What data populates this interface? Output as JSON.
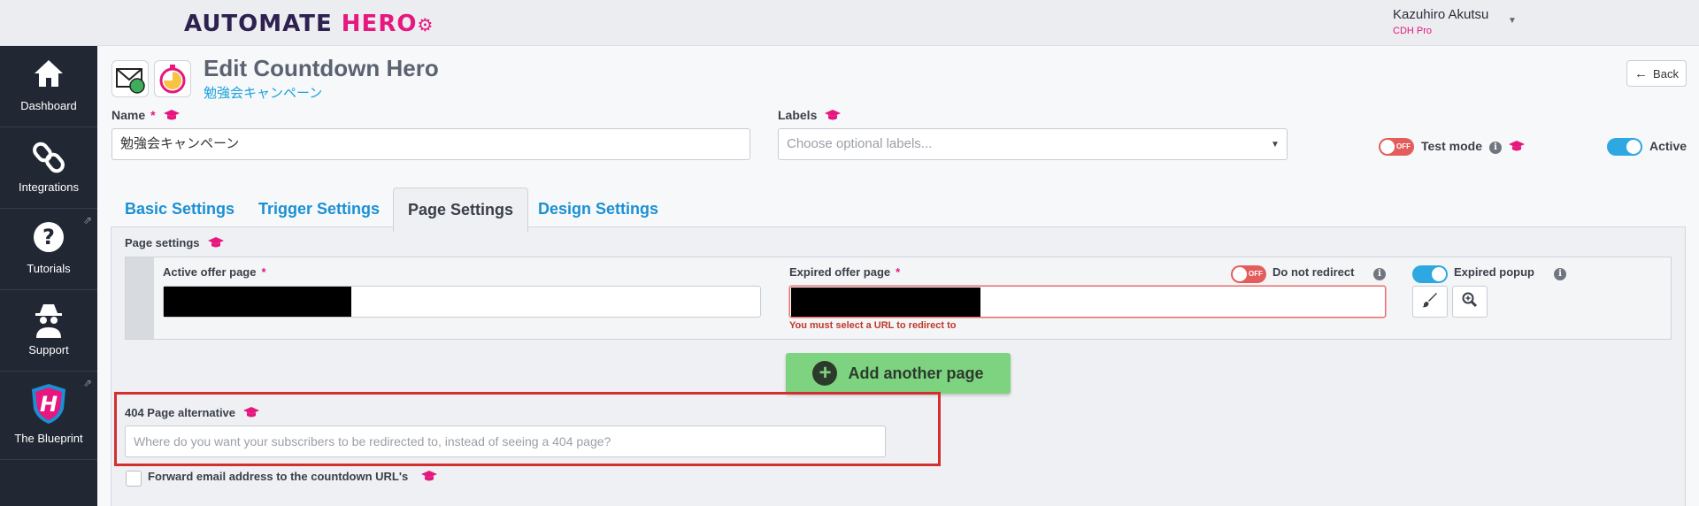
{
  "brand": {
    "logo_part1": "AUTOMATE ",
    "logo_part2": "HERO",
    "logo_suffix": "⚙"
  },
  "user": {
    "name": "Kazuhiro Akutsu",
    "plan": "CDH Pro"
  },
  "sidebar": {
    "items": [
      {
        "label": "Dashboard",
        "icon": "home-icon"
      },
      {
        "label": "Integrations",
        "icon": "link-icon"
      },
      {
        "label": "Tutorials",
        "icon": "question-icon"
      },
      {
        "label": "Support",
        "icon": "spy-icon"
      },
      {
        "label": "The Blueprint",
        "icon": "shield-logo-icon"
      }
    ]
  },
  "header": {
    "title": "Edit Countdown Hero",
    "subtitle": "勉強会キャンペーン",
    "back_label": "Back"
  },
  "form": {
    "name_label": "Name",
    "required_mark": "*",
    "name_value": "勉強会キャンペーン",
    "labels_label": "Labels",
    "labels_placeholder": "Choose optional labels...",
    "test_mode_label": "Test mode",
    "test_mode_state": "OFF",
    "active_label": "Active"
  },
  "tabs": [
    {
      "label": "Basic Settings"
    },
    {
      "label": "Trigger Settings"
    },
    {
      "label": "Page Settings"
    },
    {
      "label": "Design Settings"
    }
  ],
  "page_settings": {
    "section_label": "Page settings",
    "active_offer_label": "Active offer page",
    "expired_offer_label": "Expired offer page",
    "do_not_redirect_label": "Do not redirect",
    "do_not_redirect_state": "OFF",
    "expired_popup_label": "Expired popup",
    "error_message": "You must select a URL to redirect to",
    "add_page_label": "Add another page",
    "alt404_label": "404 Page alternative",
    "alt404_placeholder": "Where do you want your subscribers to be redirected to, instead of seeing a 404 page?",
    "forward_email_label": "Forward email address to the countdown URL's"
  },
  "colors": {
    "brand_pink": "#e6177e",
    "brand_navy": "#2e2150",
    "link_blue": "#1a90d4",
    "sidebar_bg": "#222833",
    "error_red": "#d32f2f",
    "add_green": "#7ed381"
  }
}
